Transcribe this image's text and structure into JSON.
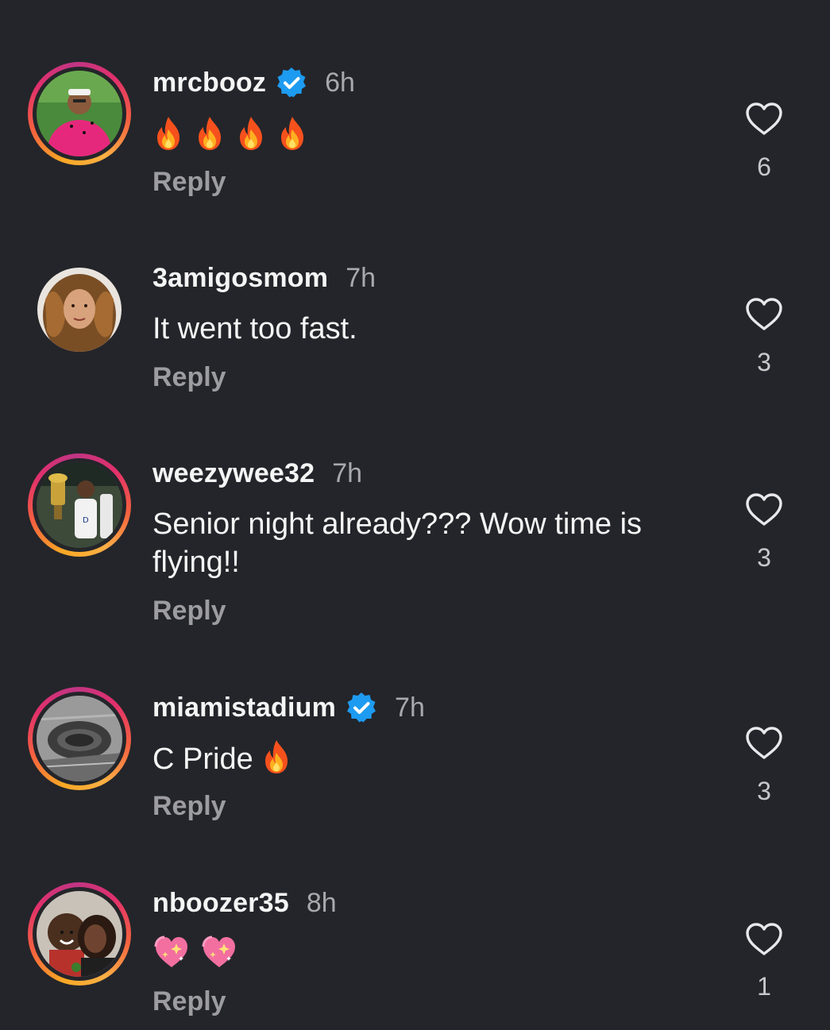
{
  "comments": [
    {
      "username": "mrcbooz",
      "verified": true,
      "time": "6h",
      "text": "",
      "emojis": [
        "fire",
        "fire",
        "fire",
        "fire"
      ],
      "reply_label": "Reply",
      "likes": "6",
      "avatar_ring": true
    },
    {
      "username": "3amigosmom",
      "verified": false,
      "time": "7h",
      "text": "It went too fast.",
      "reply_label": "Reply",
      "likes": "3",
      "avatar_ring": false
    },
    {
      "username": "weezywee32",
      "verified": false,
      "time": "7h",
      "text_line1": "Senior night already??? Wow time is",
      "text_line2": "flying!!",
      "reply_label": "Reply",
      "likes": "3",
      "avatar_ring": true
    },
    {
      "username": "miamistadium",
      "verified": true,
      "time": "7h",
      "text": "C Pride",
      "emojis": [
        "fire"
      ],
      "reply_label": "Reply",
      "likes": "3",
      "avatar_ring": true
    },
    {
      "username": "nboozer35",
      "verified": false,
      "time": "8h",
      "text": "",
      "emojis": [
        "sparkling-heart",
        "sparkling-heart"
      ],
      "reply_label": "Reply",
      "likes": "1",
      "avatar_ring": true
    }
  ],
  "colors": {
    "background": "#24252a",
    "verified_badge": "#1d9bf0",
    "secondary_text": "#a8a8ad"
  }
}
